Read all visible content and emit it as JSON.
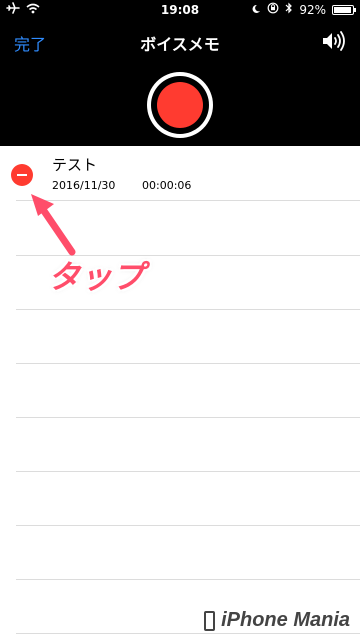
{
  "status": {
    "time": "19:08",
    "battery_text": "92%",
    "battery_level": 0.92,
    "left_icons": [
      "airplane-icon",
      "wifi-icon"
    ],
    "right_icons": [
      "moon-icon",
      "orientation-lock-icon",
      "bluetooth-icon",
      "battery-icon"
    ]
  },
  "nav": {
    "done_label": "完了",
    "title": "ボイスメモ",
    "speaker_icon": "speaker-icon"
  },
  "recordings": [
    {
      "title": "テスト",
      "date": "2016/11/30",
      "duration": "00:00:06"
    }
  ],
  "annotation": {
    "label": "タップ",
    "color": "#ff4d6a"
  },
  "watermark": {
    "text": "iPhone Mania"
  },
  "colors": {
    "accent_blue": "#2f8cff",
    "record_red": "#ff3b30"
  }
}
